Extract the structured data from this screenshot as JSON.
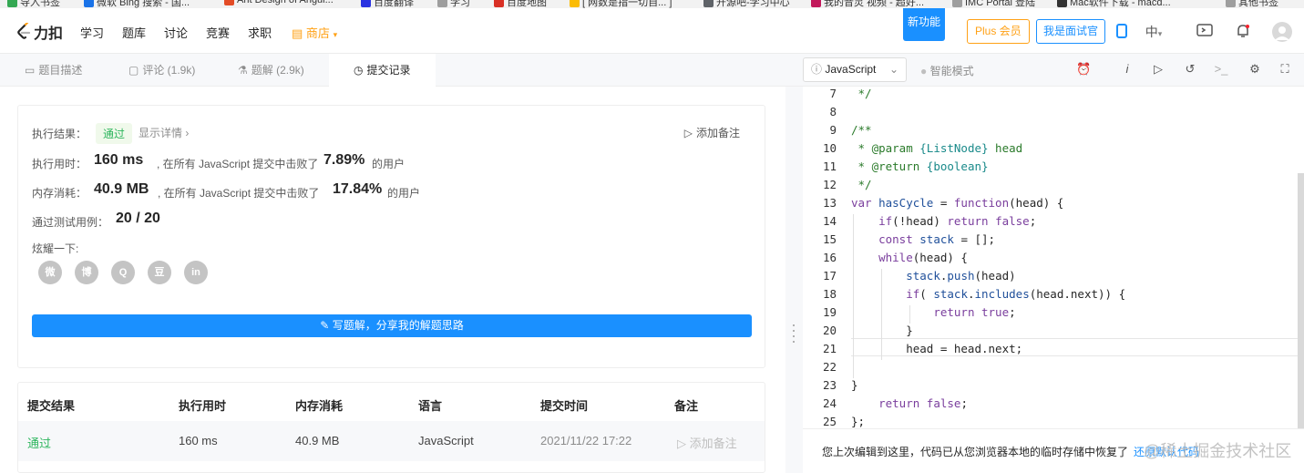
{
  "browser": {
    "bookmarks": [
      {
        "label": "导入书签",
        "color": "#34a853"
      },
      {
        "label": "微软 Bing 搜索 - 国...",
        "color": "#1a73e8"
      },
      {
        "label": "Ant Design of Angul...",
        "color": "#e34c26"
      },
      {
        "label": "百度翻译",
        "color": "#2932e1"
      },
      {
        "label": "学习",
        "color": "#9e9e9e"
      },
      {
        "label": "百度地图",
        "color": "#d93025"
      },
      {
        "label": "[ 网数是指一切自... ]",
        "color": "#fbbc04"
      },
      {
        "label": "开源吧-学习中心",
        "color": "#5f6368"
      },
      {
        "label": "我的音灵 视频 - 超好...",
        "color": "#c2185b"
      },
      {
        "label": "IMC Portal 登陆",
        "color": "#9e9e9e"
      },
      {
        "label": "Mac软件下载 - macd...",
        "color": "#333333"
      },
      {
        "label": "其他书签",
        "color": "#9e9e9e"
      }
    ]
  },
  "nav": {
    "logo_text": "力扣",
    "items": [
      "学习",
      "题库",
      "讨论",
      "竞赛",
      "求职"
    ],
    "store": "商店",
    "new_feature": "新功能",
    "plus": "Plus 会员",
    "interviewer": "我是面试官",
    "lang": "中"
  },
  "left_tabs": [
    {
      "label": "题目描述",
      "icon": "doc-icon"
    },
    {
      "label": "评论 (1.9k)",
      "icon": "comment-icon"
    },
    {
      "label": "题解 (2.9k)",
      "icon": "flask-icon"
    },
    {
      "label": "提交记录",
      "icon": "clock-icon"
    }
  ],
  "result": {
    "label_result": "执行结果：",
    "status": "通过",
    "show_detail": "显示详情 ›",
    "add_note": "添加备注",
    "label_time": "执行用时：",
    "time": "160 ms",
    "time_mid": ", 在所有 JavaScript 提交中击败了",
    "time_pct": "7.89%",
    "time_tail": "的用户",
    "label_mem": "内存消耗：",
    "mem": "40.9 MB",
    "mem_mid": ", 在所有 JavaScript 提交中击败了",
    "mem_pct": "17.84%",
    "mem_tail": "的用户",
    "label_cases": "通过测试用例：",
    "cases": "20 / 20",
    "label_share": "炫耀一下:",
    "share": [
      {
        "name": "wechat-icon",
        "glyph": "微"
      },
      {
        "name": "weibo-icon",
        "glyph": "博"
      },
      {
        "name": "qq-icon",
        "glyph": "Q"
      },
      {
        "name": "douban-icon",
        "glyph": "豆"
      },
      {
        "name": "linkedin-icon",
        "glyph": "in"
      }
    ],
    "write_solution": "写题解，分享我的解题思路"
  },
  "table": {
    "headers": [
      "提交结果",
      "执行用时",
      "内存消耗",
      "语言",
      "提交时间",
      "备注"
    ],
    "rows": [
      {
        "status": "通过",
        "time": "160 ms",
        "memory": "40.9 MB",
        "lang": "JavaScript",
        "submitted": "2021/11/22 17:22",
        "note": "添加备注"
      }
    ]
  },
  "editor": {
    "language": "JavaScript",
    "smart_mode": "智能模式",
    "lines": [
      {
        "n": "7",
        "text": " */"
      },
      {
        "n": "8",
        "text": ""
      },
      {
        "n": "9",
        "text": "/**"
      },
      {
        "n": "10",
        "text": " * @param {ListNode} head"
      },
      {
        "n": "11",
        "text": " * @return {boolean}"
      },
      {
        "n": "12",
        "text": " */"
      },
      {
        "n": "13",
        "text": "var hasCycle = function(head) {"
      },
      {
        "n": "14",
        "text": "    if(!head) return false;"
      },
      {
        "n": "15",
        "text": "    const stack = [];"
      },
      {
        "n": "16",
        "text": "    while(head) {"
      },
      {
        "n": "17",
        "text": "        stack.push(head)"
      },
      {
        "n": "18",
        "text": "        if( stack.includes(head.next)) {"
      },
      {
        "n": "19",
        "text": "            return true;"
      },
      {
        "n": "20",
        "text": "        }"
      },
      {
        "n": "21",
        "text": "        head = head.next;"
      },
      {
        "n": "22",
        "text": ""
      },
      {
        "n": "23",
        "text": "}"
      },
      {
        "n": "24",
        "text": "    return false;"
      },
      {
        "n": "25",
        "text": "};"
      }
    ],
    "notice": "您上次编辑到这里，代码已从您浏览器本地的临时存储中恢复了",
    "notice_link": "还原默认代码",
    "watermark": "@稀土掘金技术社区"
  }
}
